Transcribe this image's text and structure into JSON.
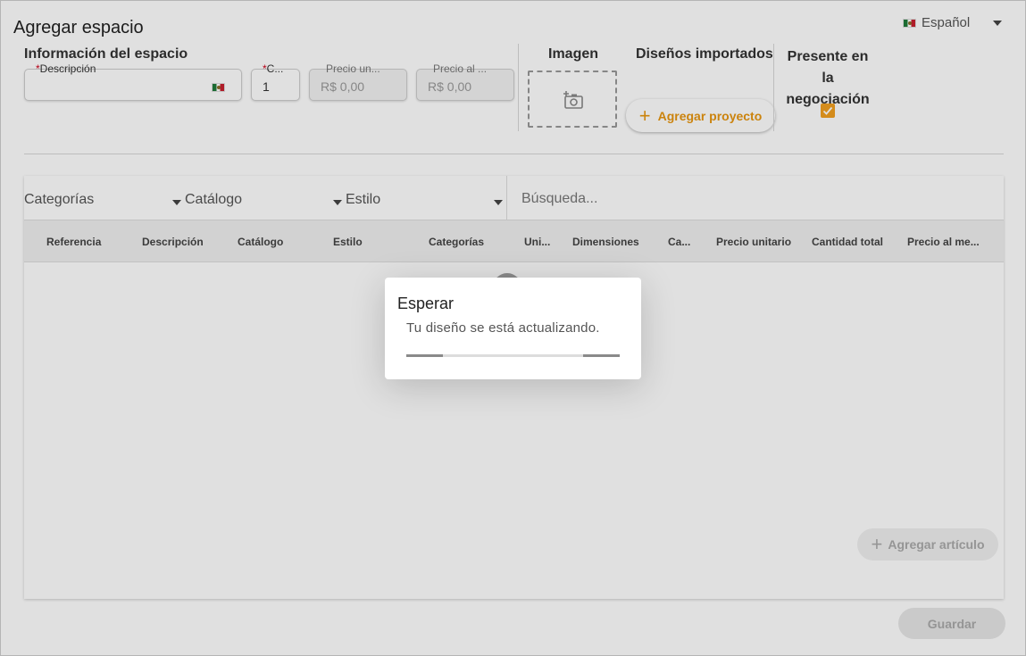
{
  "header": {
    "title": "Agregar espacio",
    "language": "Español",
    "language_icon": "mexico-flag-icon"
  },
  "space_info": {
    "section_label": "Información del espacio",
    "description": {
      "required_mark": "*",
      "label": "Descripción",
      "value": ""
    },
    "quantity": {
      "required_mark": "*",
      "label": "C...",
      "value": "1"
    },
    "unit_price": {
      "label": "Precio un...",
      "value": "R$ 0,00"
    },
    "monthly_price": {
      "label": "Precio al ...",
      "value": "R$ 0,00"
    }
  },
  "image": {
    "label": "Imagen",
    "icon": "add-photo-icon"
  },
  "imported_designs": {
    "label": "Diseños importados",
    "button": "Agregar proyecto"
  },
  "negotiation": {
    "label_line1": "Presente en la",
    "label_line2": "negociación",
    "checked": true
  },
  "filters": {
    "categories": "Categorías",
    "catalog": "Catálogo",
    "style": "Estilo",
    "search_placeholder": "Búsqueda..."
  },
  "table": {
    "columns": [
      "Referencia",
      "Descripción",
      "Catálogo",
      "Estilo",
      "Categorías",
      "Uni...",
      "Dimensiones",
      "Ca...",
      "Precio unitario",
      "Cantidad total",
      "Precio al me..."
    ]
  },
  "actions": {
    "add_article": "Agregar artículo",
    "save": "Guardar"
  },
  "dialog": {
    "title": "Esperar",
    "message": "Tu diseño se está actualizando.",
    "progress_segments": [
      [
        0,
        0.17
      ],
      [
        0.83,
        1.0
      ]
    ]
  },
  "colors": {
    "accent": "#f2a020",
    "accent_text": "#e8960f"
  }
}
